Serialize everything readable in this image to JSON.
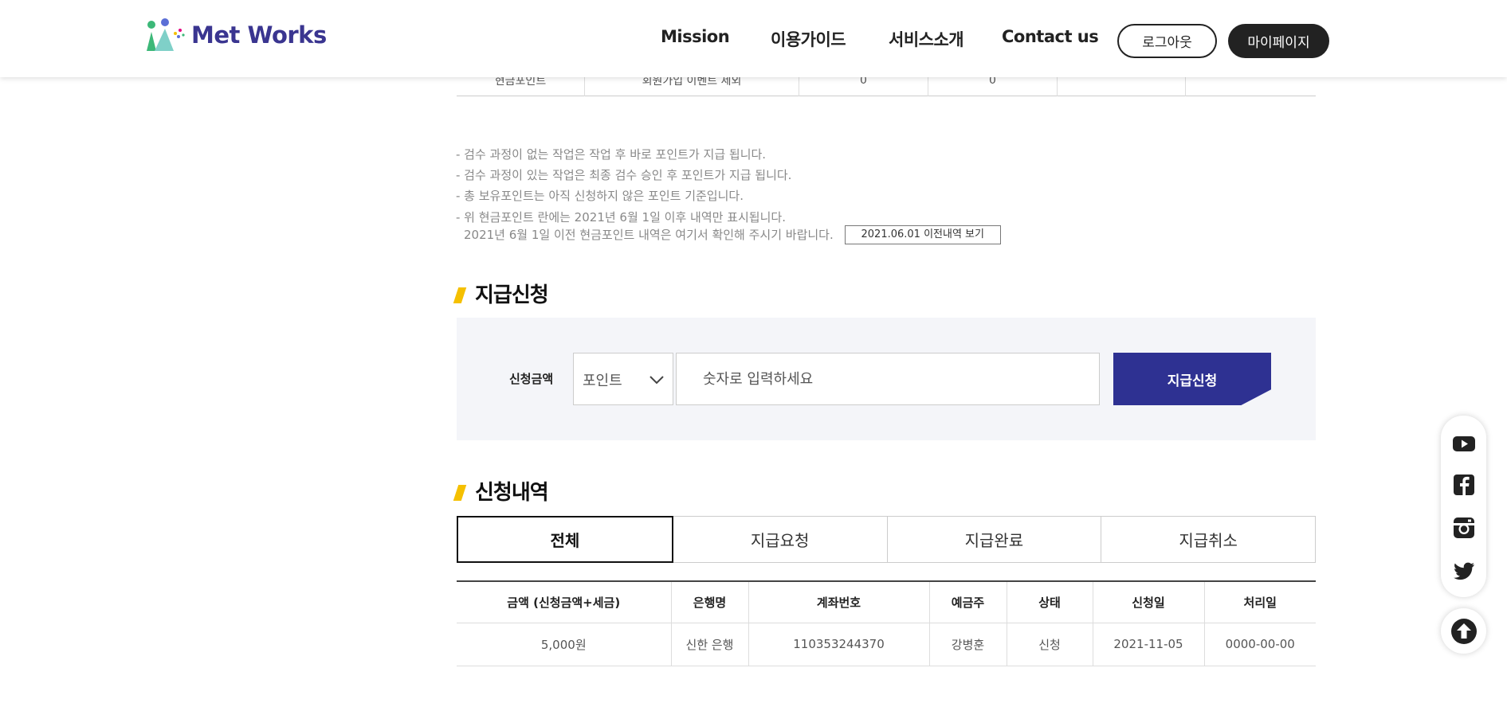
{
  "header": {
    "logo_text": "Met Works",
    "nav": [
      "Mission",
      "이용가이드",
      "서비스소개",
      "Contact us"
    ],
    "logout_label": "로그아웃",
    "mypage_label": "마이페이지"
  },
  "top_table_row": [
    "현금포인트",
    "회원가입 이벤트 제외",
    "0",
    "0",
    "",
    ""
  ],
  "notes": {
    "line1": "- 검수 과정이 없는 작업은 작업 후 바로 포인트가 지급 됩니다.",
    "line2": "- 검수 과정이 있는 작업은 최종 검수 승인 후 포인트가 지급 됩니다.",
    "line3": "- 총 보유포인트는 아직 신청하지 않은 포인트 기준입니다.",
    "line4": "- 위 현금포인트 란에는 2021년 6월 1일 이후 내역만 표시됩니다.",
    "line5": "2021년 6월 1일 이전 현금포인트 내역은 여기서 확인해 주시기 바랍니다.",
    "history_button": "2021.06.01 이전내역 보기"
  },
  "request": {
    "title": "지급신청",
    "amount_label": "신청금액",
    "select_value": "포인트",
    "input_placeholder": "숫자로 입력하세요",
    "submit_label": "지급신청"
  },
  "history": {
    "title": "신청내역",
    "tabs": [
      "전체",
      "지급요청",
      "지급완료",
      "지급취소"
    ],
    "columns": [
      "금액 (신청금액+세금)",
      "은행명",
      "계좌번호",
      "예금주",
      "상태",
      "신청일",
      "처리일"
    ],
    "rows": [
      [
        "5,000원",
        "신한 은행",
        "110353244370",
        "강병훈",
        "신청",
        "2021-11-05",
        "0000-00-00"
      ]
    ]
  },
  "social_icons": [
    "youtube-icon",
    "facebook-icon",
    "instagram-icon",
    "twitter-icon"
  ],
  "colors": {
    "brand": "#2e3192",
    "accent": "#f5c000",
    "logo": "#3a3590"
  }
}
